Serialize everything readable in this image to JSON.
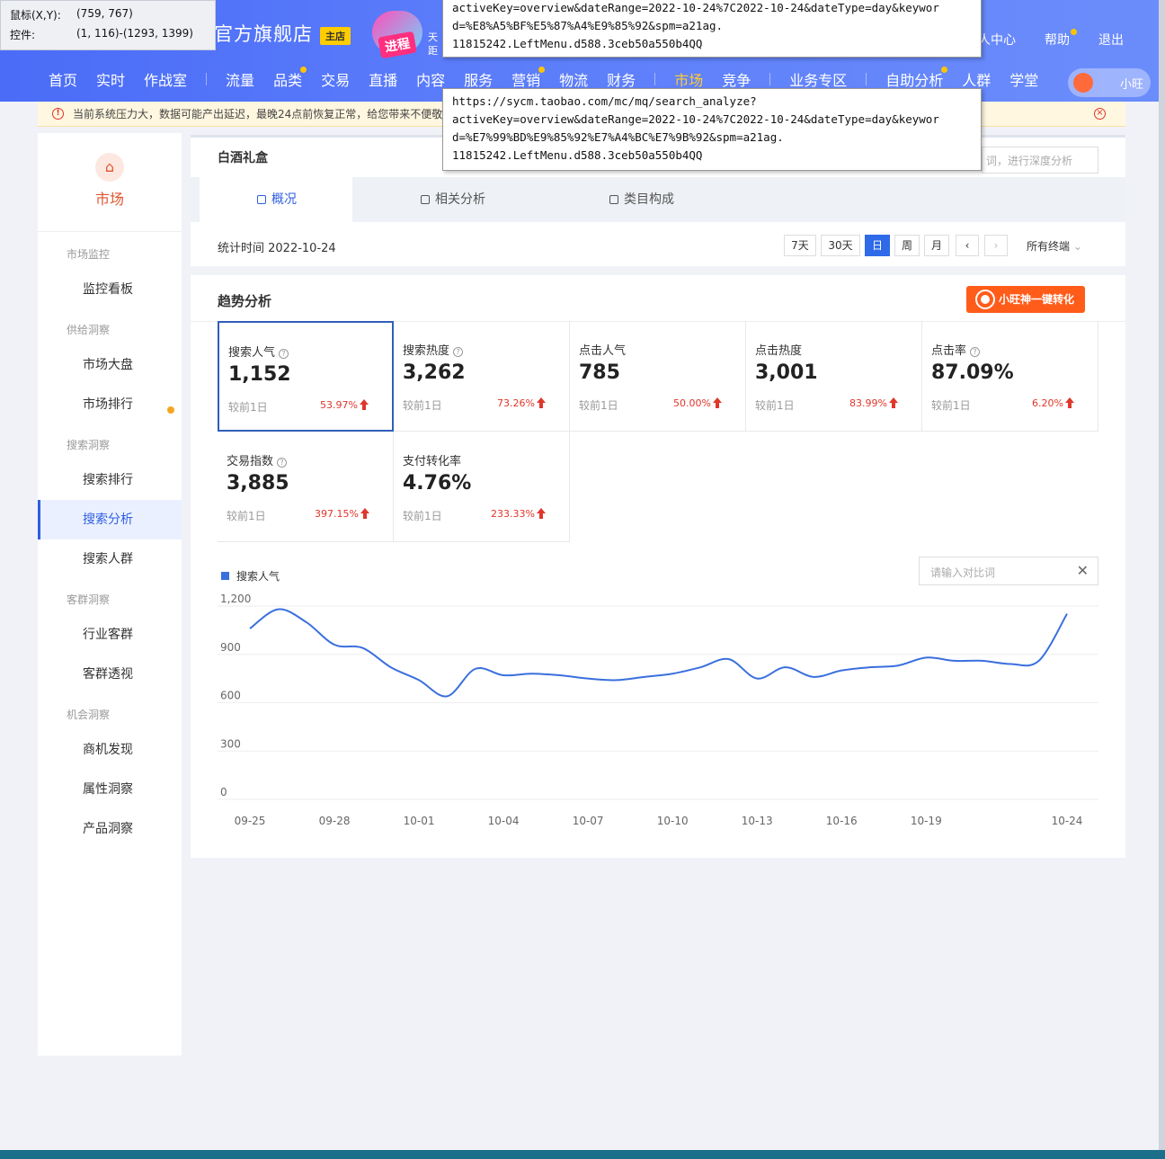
{
  "inspector": {
    "mouse_label": "鼠标(X,Y):",
    "mouse_value": "(759, 767)",
    "control_label": "控件:",
    "control_value": "(1, 116)-(1293, 1399)"
  },
  "header": {
    "store_name": "官方旗舰店",
    "store_badge": "主店",
    "promo_tag": "进程",
    "promo_side_1": "天",
    "promo_side_2": "距",
    "user_links": [
      "人中心",
      "帮助",
      "退出"
    ],
    "xiaowang": "小旺"
  },
  "nav": {
    "group1": [
      "首页",
      "实时",
      "作战室"
    ],
    "group2": [
      "流量",
      "品类",
      "交易",
      "直播",
      "内容",
      "服务",
      "营销",
      "物流",
      "财务"
    ],
    "group3": [
      "市场",
      "竞争"
    ],
    "group4": [
      "业务专区"
    ],
    "group5": [
      "自助分析",
      "人群",
      "学堂"
    ]
  },
  "tooltips": {
    "url_top": "activeKey=overview&dateRange=2022-10-24%7C2022-10-24&dateType=day&keywor\nd=%E8%A5%BF%E5%87%A4%E9%85%92&spm=a21ag.\n11815242.LeftMenu.d588.3ceb50a550b4QQ",
    "url_bottom": "https://sycm.taobao.com/mc/mq/search_analyze?\nactiveKey=overview&dateRange=2022-10-24%7C2022-10-24&dateType=day&keywor\nd=%E7%99%BD%E9%85%92%E7%A4%BC%E7%9B%92&spm=a21ag.\n11815242.LeftMenu.d588.3ceb50a550b4QQ"
  },
  "alert": {
    "text": "当前系统压力大，数据可能产出延迟，最晚24点前恢复正常，给您带来不便敬"
  },
  "sidebar": {
    "title": "市场",
    "groups": {
      "g1": "市场监控",
      "g2": "供给洞察",
      "g3": "搜索洞察",
      "g4": "客群洞察",
      "g5": "机会洞察"
    },
    "items": {
      "i1": "监控看板",
      "i2": "市场大盘",
      "i3": "市场排行",
      "i4": "搜索排行",
      "i5": "搜索分析",
      "i6": "搜索人群",
      "i7": "行业客群",
      "i8": "客群透视",
      "i9": "商机发现",
      "i10": "属性洞察",
      "i11": "产品洞察"
    }
  },
  "main": {
    "keyword": "白酒礼盒",
    "deep_placeholder": "词，进行深度分析",
    "tabs": [
      "概况",
      "相关分析",
      "类目构成"
    ],
    "stat_time": "统计时间 2022-10-24",
    "date_buttons": [
      "7天",
      "30天",
      "日",
      "周",
      "月",
      "‹",
      "›"
    ],
    "terminal": "所有终端"
  },
  "trend": {
    "title": "趋势分析",
    "convert_button": "小旺神一键转化",
    "compare_placeholder": "请输入对比词",
    "metrics": [
      {
        "label": "搜索人气",
        "value": "1,152",
        "cmp": "较前1日",
        "pct": "53.97%"
      },
      {
        "label": "搜索热度",
        "value": "3,262",
        "cmp": "较前1日",
        "pct": "73.26%"
      },
      {
        "label": "点击人气",
        "value": "785",
        "cmp": "较前1日",
        "pct": "50.00%"
      },
      {
        "label": "点击热度",
        "value": "3,001",
        "cmp": "较前1日",
        "pct": "83.99%"
      },
      {
        "label": "点击率",
        "value": "87.09%",
        "cmp": "较前1日",
        "pct": "6.20%"
      },
      {
        "label": "交易指数",
        "value": "3,885",
        "cmp": "较前1日",
        "pct": "397.15%"
      },
      {
        "label": "支付转化率",
        "value": "4.76%",
        "cmp": "较前1日",
        "pct": "233.33%"
      }
    ]
  },
  "chart_data": {
    "type": "line",
    "xlabel": "",
    "ylabel": "",
    "ylim": [
      0,
      1200
    ],
    "yticks": [
      0,
      300,
      600,
      900,
      1200
    ],
    "ytick_labels": [
      "0",
      "300",
      "600",
      "900",
      "1,200"
    ],
    "x": [
      "09-25",
      "09-26",
      "09-27",
      "09-28",
      "09-29",
      "09-30",
      "10-01",
      "10-02",
      "10-03",
      "10-04",
      "10-05",
      "10-06",
      "10-07",
      "10-08",
      "10-09",
      "10-10",
      "10-11",
      "10-12",
      "10-13",
      "10-14",
      "10-15",
      "10-16",
      "10-17",
      "10-18",
      "10-19",
      "10-20",
      "10-21",
      "10-22",
      "10-23",
      "10-24"
    ],
    "xtick_labels": [
      "09-25",
      "09-28",
      "10-01",
      "10-04",
      "10-07",
      "10-10",
      "10-13",
      "10-16",
      "10-19",
      "10-24"
    ],
    "series": [
      {
        "name": "搜索人气",
        "color": "#3a6fde",
        "values": [
          1060,
          1180,
          1100,
          960,
          940,
          820,
          740,
          640,
          810,
          770,
          780,
          770,
          750,
          740,
          760,
          780,
          820,
          870,
          750,
          820,
          760,
          800,
          820,
          830,
          880,
          860,
          860,
          840,
          860,
          1152
        ]
      }
    ],
    "grid": true,
    "legend": "top-left"
  }
}
